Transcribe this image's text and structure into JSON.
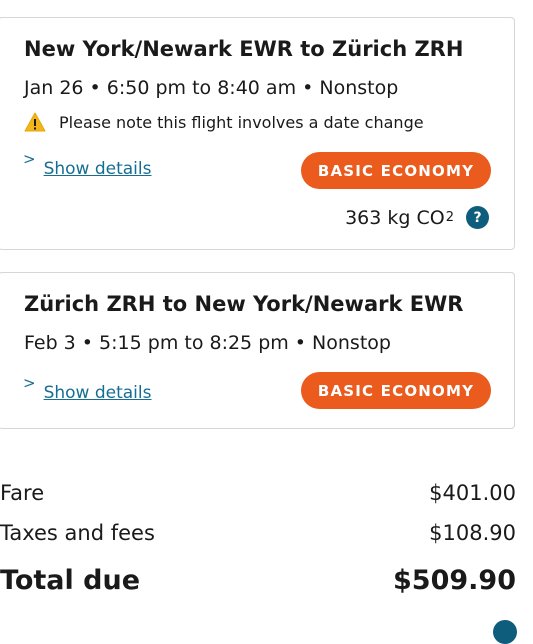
{
  "outbound": {
    "route": "New York/Newark EWR to Zürich ZRH",
    "schedule": "Jan 26 • 6:50 pm to 8:40 am • Nonstop",
    "date_note": "Please note this flight involves a date change",
    "details_label": "Show details",
    "fare_class": "BASIC ECONOMY",
    "co2_value": "363 kg CO",
    "co2_subscript": "2"
  },
  "return": {
    "route": "Zürich ZRH to New York/Newark EWR",
    "schedule": "Feb 3 • 5:15 pm to 8:25 pm • Nonstop",
    "details_label": "Show details",
    "fare_class": "BASIC ECONOMY"
  },
  "summary": {
    "fare_label": "Fare",
    "fare_value": "$401.00",
    "taxes_label": "Taxes and fees",
    "taxes_value": "$108.90",
    "total_label": "Total due",
    "total_value": "$509.90"
  },
  "colors": {
    "accent": "#ea5b1d",
    "link": "#166d93",
    "info_icon": "#0e5d7d",
    "warning": "#f2b51b"
  },
  "icons": {
    "warning": "warning-triangle-icon",
    "info": "question-circle-icon",
    "expand": "chevron-right-icon"
  }
}
